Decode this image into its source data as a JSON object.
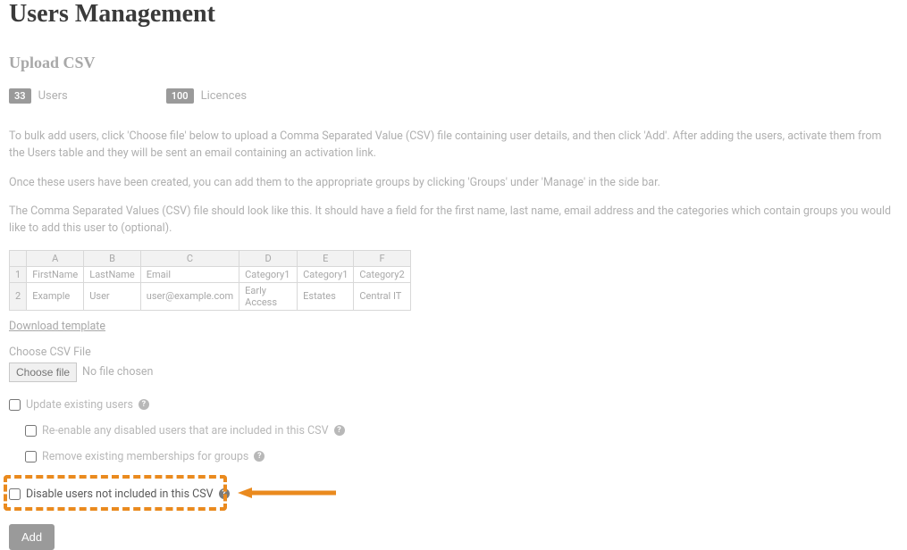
{
  "page_title": "Users Management",
  "subtitle": "Upload CSV",
  "stats": {
    "users_count": "33",
    "users_label": "Users",
    "licences_count": "100",
    "licences_label": "Licences"
  },
  "instructions": {
    "p1": "To bulk add users, click 'Choose file' below to upload a Comma Separated Value (CSV) file containing user details, and then click 'Add'. After adding the users, activate them from the Users table and they will be sent an email containing an activation link.",
    "p2": "Once these users have been created, you can add them to the appropriate groups by clicking 'Groups' under 'Manage' in the side bar.",
    "p3": "The Comma Separated Values (CSV) file should look like this. It should have a field for the first name, last name, email address and the categories which contain groups you would like to add this user to (optional)."
  },
  "csv_preview": {
    "cols": [
      "A",
      "B",
      "C",
      "D",
      "E",
      "F"
    ],
    "row_nums": [
      "1",
      "2"
    ],
    "header_row": [
      "FirstName",
      "LastName",
      "Email",
      "Category1",
      "Category1",
      "Category2"
    ],
    "data_row": [
      "Example",
      "User",
      "user@example.com",
      "Early Access",
      "Estates",
      "Central IT"
    ]
  },
  "download_template": "Download template",
  "choose_file": {
    "label": "Choose CSV File",
    "button": "Choose file",
    "status": "No file chosen"
  },
  "checkboxes": {
    "update_existing": "Update existing users",
    "reenable_disabled": "Re-enable any disabled users that are included in this CSV",
    "remove_memberships": "Remove existing memberships for groups",
    "disable_not_included": "Disable users not included in this CSV"
  },
  "help_icon": "?",
  "add_button": "Add"
}
